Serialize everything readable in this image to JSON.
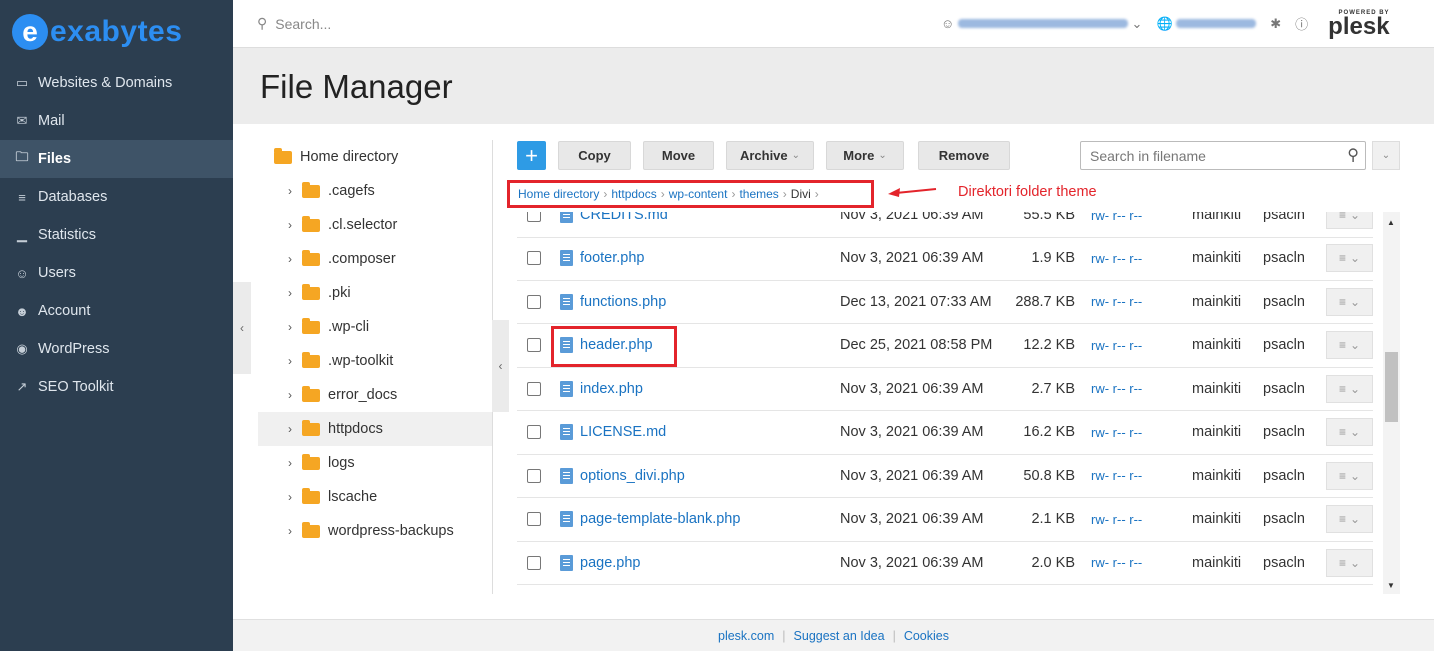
{
  "brand": {
    "mark": "e",
    "name": "exabytes"
  },
  "sidebar": {
    "items": [
      {
        "label": "Websites & Domains",
        "icon": "monitor-icon"
      },
      {
        "label": "Mail",
        "icon": "mail-icon"
      },
      {
        "label": "Files",
        "icon": "folder-icon",
        "active": true
      },
      {
        "label": "Databases",
        "icon": "database-icon"
      },
      {
        "label": "Statistics",
        "icon": "chart-icon"
      },
      {
        "label": "Users",
        "icon": "user-icon"
      },
      {
        "label": "Account",
        "icon": "account-icon"
      },
      {
        "label": "WordPress",
        "icon": "wordpress-icon"
      },
      {
        "label": "SEO Toolkit",
        "icon": "seo-icon"
      }
    ]
  },
  "header": {
    "search_placeholder": "Search...",
    "powered_by": "POWERED BY",
    "plesk": "plesk"
  },
  "page": {
    "title": "File Manager"
  },
  "tree": {
    "root": "Home directory",
    "items": [
      {
        "label": ".cagefs"
      },
      {
        "label": ".cl.selector"
      },
      {
        "label": ".composer"
      },
      {
        "label": ".pki"
      },
      {
        "label": ".wp-cli"
      },
      {
        "label": ".wp-toolkit"
      },
      {
        "label": "error_docs"
      },
      {
        "label": "httpdocs",
        "selected": true
      },
      {
        "label": "logs"
      },
      {
        "label": "lscache"
      },
      {
        "label": "wordpress-backups"
      }
    ]
  },
  "toolbar": {
    "add": "+",
    "copy": "Copy",
    "move": "Move",
    "archive": "Archive",
    "more": "More",
    "remove": "Remove",
    "search_placeholder": "Search in filename"
  },
  "breadcrumb": {
    "parts": [
      "Home directory",
      "httpdocs",
      "wp-content",
      "themes"
    ],
    "current": "Divi"
  },
  "annotation": {
    "text": "Direktori folder theme",
    "color": "#e3242b"
  },
  "files": [
    {
      "name": "CREDITS.md",
      "date": "Nov 3, 2021 06:39 AM",
      "size": "55.5 KB",
      "perm": "rw- r-- r--",
      "user": "mainkiti",
      "group": "psacln"
    },
    {
      "name": "footer.php",
      "date": "Nov 3, 2021 06:39 AM",
      "size": "1.9 KB",
      "perm": "rw- r-- r--",
      "user": "mainkiti",
      "group": "psacln"
    },
    {
      "name": "functions.php",
      "date": "Dec 13, 2021 07:33 AM",
      "size": "288.7 KB",
      "perm": "rw- r-- r--",
      "user": "mainkiti",
      "group": "psacln"
    },
    {
      "name": "header.php",
      "date": "Dec 25, 2021 08:58 PM",
      "size": "12.2 KB",
      "perm": "rw- r-- r--",
      "user": "mainkiti",
      "group": "psacln"
    },
    {
      "name": "index.php",
      "date": "Nov 3, 2021 06:39 AM",
      "size": "2.7 KB",
      "perm": "rw- r-- r--",
      "user": "mainkiti",
      "group": "psacln"
    },
    {
      "name": "LICENSE.md",
      "date": "Nov 3, 2021 06:39 AM",
      "size": "16.2 KB",
      "perm": "rw- r-- r--",
      "user": "mainkiti",
      "group": "psacln"
    },
    {
      "name": "options_divi.php",
      "date": "Nov 3, 2021 06:39 AM",
      "size": "50.8 KB",
      "perm": "rw- r-- r--",
      "user": "mainkiti",
      "group": "psacln"
    },
    {
      "name": "page-template-blank.php",
      "date": "Nov 3, 2021 06:39 AM",
      "size": "2.1 KB",
      "perm": "rw- r-- r--",
      "user": "mainkiti",
      "group": "psacln"
    },
    {
      "name": "page.php",
      "date": "Nov 3, 2021 06:39 AM",
      "size": "2.0 KB",
      "perm": "rw- r-- r--",
      "user": "mainkiti",
      "group": "psacln"
    }
  ],
  "footer": {
    "links": [
      "plesk.com",
      "Suggest an Idea",
      "Cookies"
    ]
  },
  "colors": {
    "sidebar_bg": "#2c3e50",
    "accent": "#2e9be5",
    "link": "#1a73c2",
    "folder": "#f5a623",
    "highlight": "#e3242b"
  }
}
